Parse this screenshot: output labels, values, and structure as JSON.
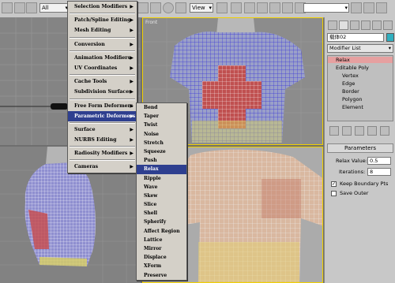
{
  "toolbar": {
    "selection_filter": "All",
    "view_mode": "View",
    "named_selection": ""
  },
  "viewports": {
    "front_label": "Front"
  },
  "modifiers_menu": {
    "items": [
      {
        "label": "Selection Modifiers",
        "submenu": true
      },
      {
        "label": "Patch/Spline Editing",
        "submenu": true
      },
      {
        "label": "Mesh Editing",
        "submenu": true
      },
      {
        "label": "Conversion",
        "submenu": true
      },
      {
        "label": "Animation Modifiers",
        "submenu": true
      },
      {
        "label": "UV Coordinates",
        "submenu": true
      },
      {
        "label": "Cache Tools",
        "submenu": true
      },
      {
        "label": "Subdivision Surfaces",
        "submenu": true
      },
      {
        "label": "Free Form Deformers",
        "submenu": true
      },
      {
        "label": "Parametric Deformers",
        "submenu": true
      },
      {
        "label": "Surface",
        "submenu": true
      },
      {
        "label": "NURBS Editing",
        "submenu": true
      },
      {
        "label": "Radiosity Modifiers",
        "submenu": true
      },
      {
        "label": "Cameras",
        "submenu": true
      }
    ],
    "highlighted": "Parametric Deformers"
  },
  "parametric_submenu": {
    "items": [
      "Bend",
      "Taper",
      "Twist",
      "Noise",
      "Stretch",
      "Squeeze",
      "Push",
      "Relax",
      "Ripple",
      "Wave",
      "Skew",
      "Slice",
      "Shell",
      "Spherify",
      "Affect Region",
      "Lattice",
      "Mirror",
      "Displace",
      "XForm",
      "Preserve"
    ],
    "highlighted": "Relax"
  },
  "command_panel": {
    "object_name": "载体02",
    "modifier_list_label": "Modifier List",
    "stack": [
      {
        "label": "Relax",
        "level": 0,
        "active": true
      },
      {
        "label": "Editable Poly",
        "level": 0,
        "active": false
      },
      {
        "label": "Vertex",
        "level": 1,
        "active": false
      },
      {
        "label": "Edge",
        "level": 1,
        "active": false
      },
      {
        "label": "Border",
        "level": 1,
        "active": false
      },
      {
        "label": "Polygon",
        "level": 1,
        "active": false
      },
      {
        "label": "Element",
        "level": 1,
        "active": false
      }
    ],
    "parameters_title": "Parameters",
    "relax_value_label": "Relax Value:",
    "relax_value": "0.5",
    "iterations_label": "Iterations:",
    "iterations_value": "8",
    "keep_boundary_label": "Keep Boundary Pts",
    "keep_boundary_checked": true,
    "save_outer_label": "Save Outer",
    "save_outer_checked": false
  },
  "watermark": "",
  "colors": {
    "menu_highlight": "#2e3f8f",
    "viewport_active_border": "#f0d000",
    "relax_highlight": "#e6a0a0",
    "mesh_wire": "#ffffff",
    "panel_bg": "#c8c8c8"
  }
}
